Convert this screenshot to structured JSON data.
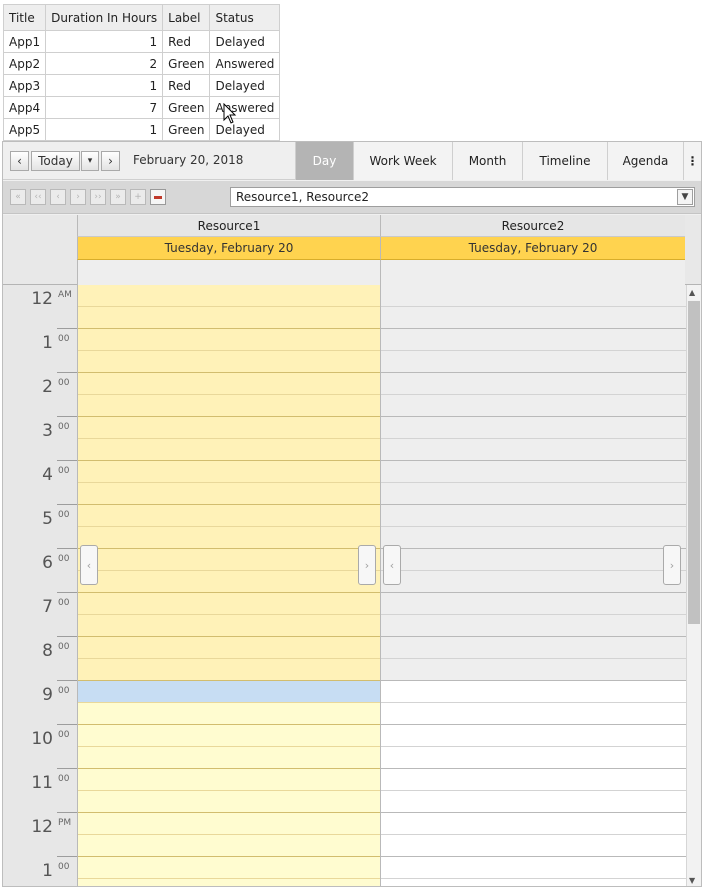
{
  "grid": {
    "columns": [
      "Title",
      "Duration In Hours",
      "Label",
      "Status"
    ],
    "rows": [
      [
        "App1",
        "1",
        "Red",
        "Delayed"
      ],
      [
        "App2",
        "2",
        "Green",
        "Answered"
      ],
      [
        "App3",
        "1",
        "Red",
        "Delayed"
      ],
      [
        "App4",
        "7",
        "Green",
        "Answered"
      ],
      [
        "App5",
        "1",
        "Green",
        "Delayed"
      ]
    ]
  },
  "toolbar": {
    "prev": "‹",
    "today": "Today",
    "dropdown": "▾",
    "next": "›",
    "date": "February 20, 2018",
    "more": "⋮",
    "views": [
      "Day",
      "Work Week",
      "Month",
      "Timeline",
      "Agenda"
    ],
    "active_view": "Day"
  },
  "resource_bar": {
    "buttons": [
      "«",
      "‹‹",
      "‹",
      "›",
      "››",
      "»",
      "+",
      "−"
    ],
    "selected": "Resource1, Resource2"
  },
  "resources": [
    {
      "name": "Resource1",
      "date": "Tuesday, February 20"
    },
    {
      "name": "Resource2",
      "date": "Tuesday, February 20"
    }
  ],
  "hours": [
    {
      "h": "12",
      "s": "AM"
    },
    {
      "h": "1",
      "s": "00"
    },
    {
      "h": "2",
      "s": "00"
    },
    {
      "h": "3",
      "s": "00"
    },
    {
      "h": "4",
      "s": "00"
    },
    {
      "h": "5",
      "s": "00"
    },
    {
      "h": "6",
      "s": "00"
    },
    {
      "h": "7",
      "s": "00"
    },
    {
      "h": "8",
      "s": "00"
    },
    {
      "h": "9",
      "s": "00"
    },
    {
      "h": "10",
      "s": "00"
    },
    {
      "h": "11",
      "s": "00"
    },
    {
      "h": "12",
      "s": "PM"
    },
    {
      "h": "1",
      "s": "00"
    }
  ],
  "colors": {
    "date_header": "#ffd34f",
    "res1_nonwork": "#fff2b8",
    "res1_work": "#fffcd0",
    "res2_nonwork": "#eeeeee",
    "res2_work": "#ffffff",
    "selected_slot": "#c7ddf3",
    "active_tab": "#b4b4b4"
  },
  "work_start_hour_index": 9,
  "selected_slot_index": 18
}
